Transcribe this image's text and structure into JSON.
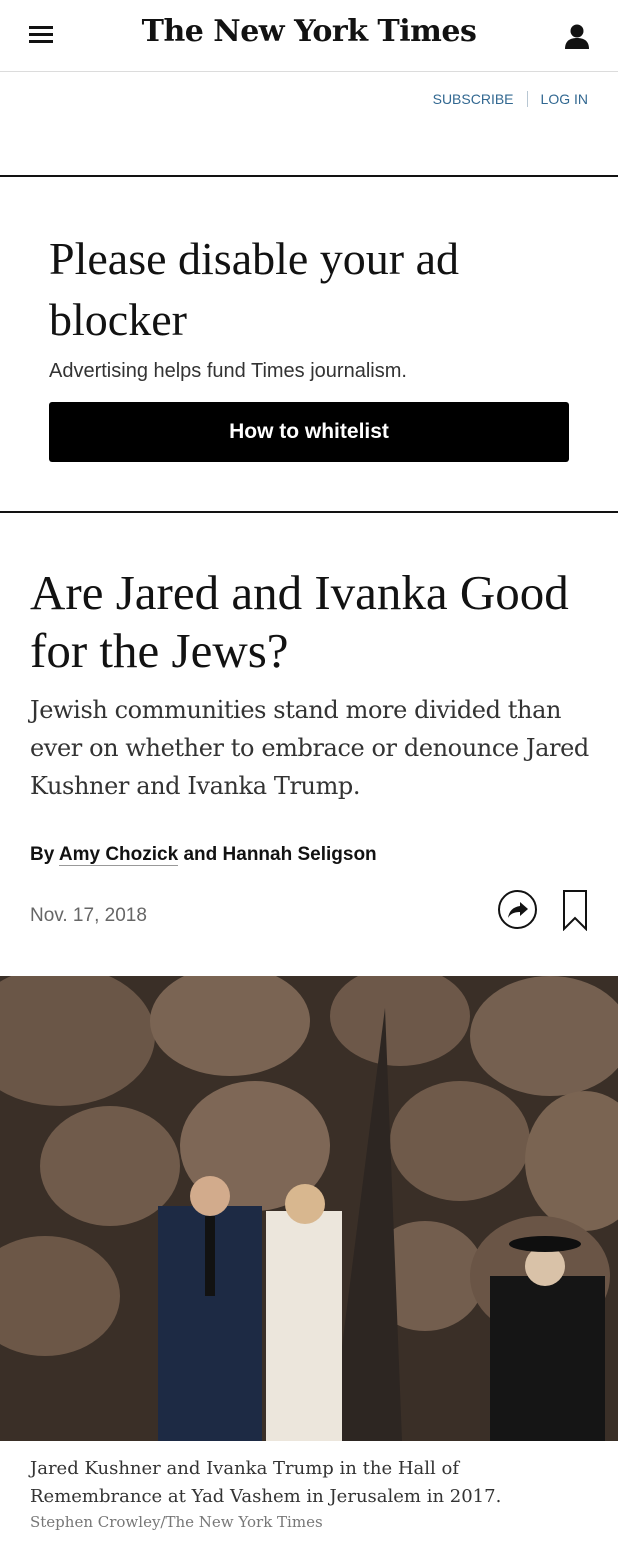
{
  "header": {
    "masthead": "The New York Times",
    "menu_icon": "hamburger-menu-icon",
    "account_icon": "person-icon",
    "subscribe_label": "SUBSCRIBE",
    "login_label": "LOG IN"
  },
  "adblock": {
    "title": "Please disable your ad blocker",
    "subtitle": "Advertising helps fund Times journalism.",
    "button_label": "How to whitelist"
  },
  "article": {
    "headline": "Are Jared and Ivanka Good for the Jews?",
    "summary": "Jewish communities stand more divided than ever on whether to embrace or denounce Jared Kushner and Ivanka Trump.",
    "byline_prefix": "By",
    "author1": "Amy Chozick",
    "byline_and": "and",
    "author2": "Hannah Seligson",
    "date": "Nov. 17, 2018",
    "share_icon": "share-arrow-icon",
    "bookmark_icon": "bookmark-icon"
  },
  "photo": {
    "caption": "Jared Kushner and Ivanka Trump in the Hall of Remembrance at Yad Vashem in Jerusalem in 2017.",
    "credit": "Stephen Crowley/The New York Times"
  },
  "colors": {
    "link_blue": "#326891",
    "text": "#121212",
    "button_bg": "#000000"
  }
}
